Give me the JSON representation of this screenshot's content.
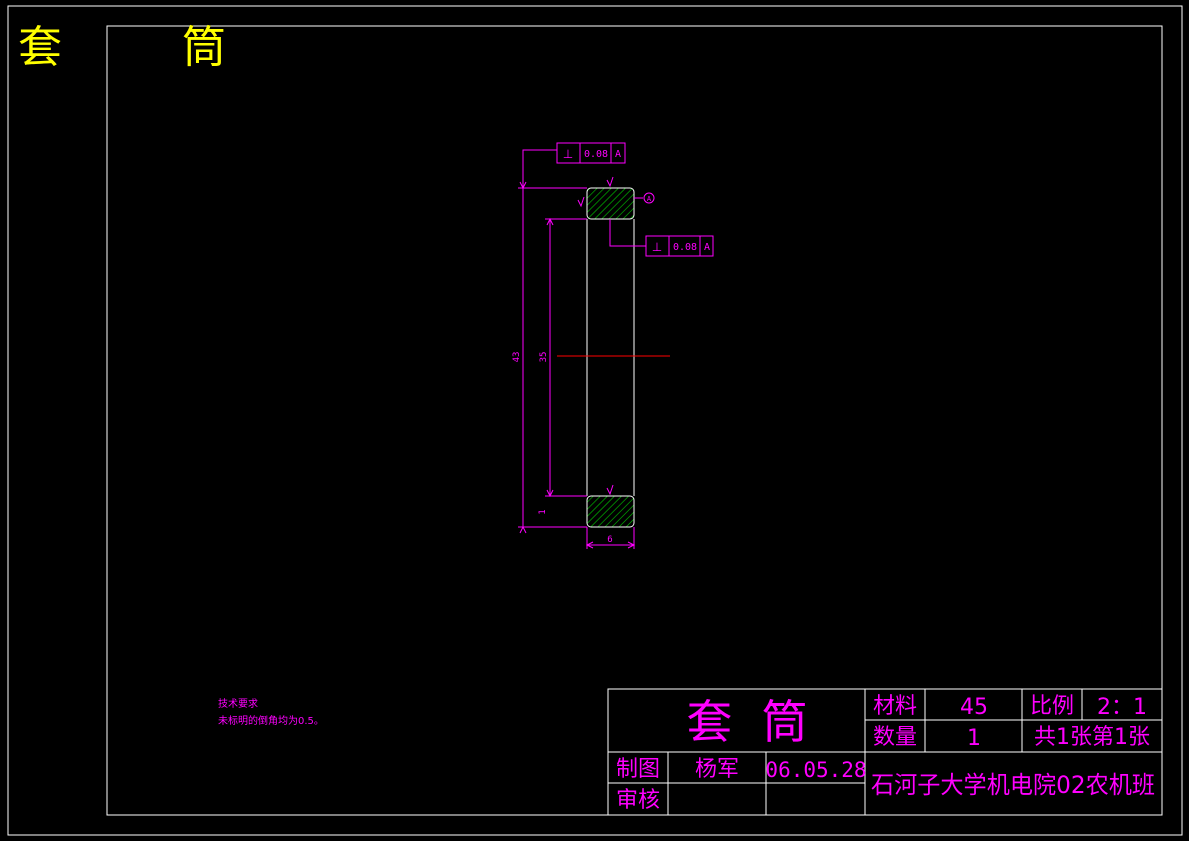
{
  "drawing": {
    "corner_title": [
      "套",
      "筒"
    ],
    "dimensions": {
      "overall_height": "43",
      "inner_height": "35",
      "width": "6",
      "chamfer": "1"
    },
    "tolerances": [
      {
        "symbol": "⊥",
        "value": "0.08",
        "datum": "A"
      },
      {
        "symbol": "⊥",
        "value": "0.08",
        "datum": "A"
      }
    ],
    "datum_label": "A",
    "tech_notes": {
      "heading": "技术要求",
      "line1": "未标明的倒角均为0.5。"
    }
  },
  "title_block": {
    "part_name": "套  筒",
    "material_label": "材料",
    "material_value": "45",
    "scale_label": "比例",
    "scale_value": "2：1",
    "quantity_label": "数量",
    "quantity_value": "1",
    "sheet_info": "共1张第1张",
    "drawn_label": "制图",
    "drawn_name": "杨军",
    "drawn_date": "06.05.28",
    "review_label": "审核",
    "organization": "石河子大学机电院02农机班"
  },
  "colors": {
    "background": "#000000",
    "border": "#ffffff",
    "dimension": "#ff00ff",
    "hatch": "#00cc00",
    "outline": "#ffffff",
    "centerline": "#ff0000",
    "title_yellow": "#ffff00"
  }
}
